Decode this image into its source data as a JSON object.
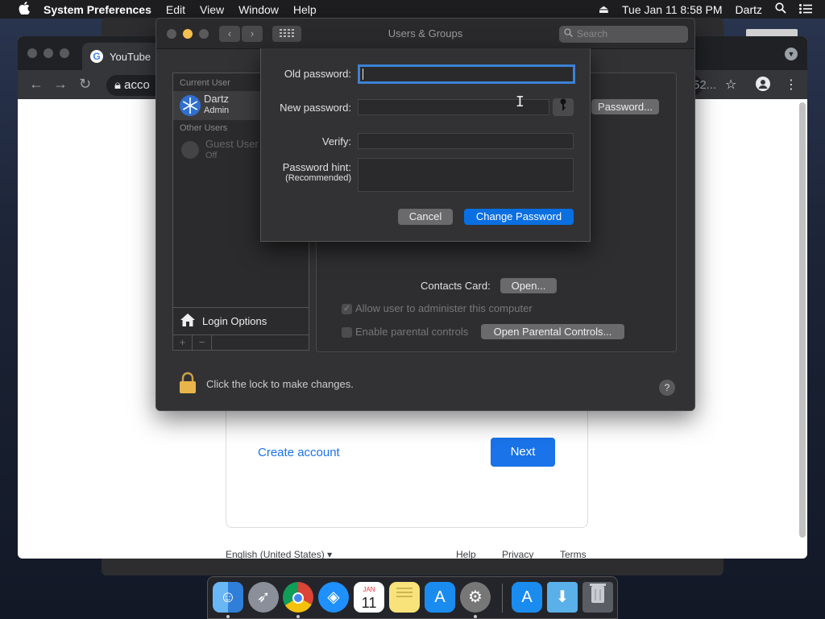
{
  "menubar": {
    "apple": "",
    "app_name": "System Preferences",
    "menus": [
      "Edit",
      "View",
      "Window",
      "Help"
    ],
    "datetime": "Tue Jan 11  8:58 PM",
    "user": "Dartz"
  },
  "chrome": {
    "tab_title": "YouTube",
    "omnibox_text": "acco",
    "omnibox_tail": "52...",
    "create_account": "Create account",
    "next": "Next",
    "language": "English (United States)",
    "footer_help": "Help",
    "footer_privacy": "Privacy",
    "footer_terms": "Terms"
  },
  "sysprefs": {
    "title": "Users & Groups",
    "search_placeholder": "Search",
    "current_user_header": "Current User",
    "current_user_name": "Dartz",
    "current_user_role": "Admin",
    "other_users_header": "Other Users",
    "guest_name": "Guest User",
    "guest_status": "Off",
    "login_options": "Login Options",
    "change_password_btn": "Password...",
    "contacts_card_label": "Contacts Card:",
    "open_btn": "Open...",
    "allow_admin": "Allow user to administer this computer",
    "enable_parental": "Enable parental controls",
    "open_parental_btn": "Open Parental Controls...",
    "lock_text": "Click the lock to make changes.",
    "help": "?"
  },
  "sheet": {
    "old_password_label": "Old password:",
    "new_password_label": "New password:",
    "verify_label": "Verify:",
    "hint_label": "Password hint:",
    "hint_sub": "(Recommended)",
    "old_password_value": "",
    "cancel": "Cancel",
    "change_password": "Change Password"
  },
  "dock": {
    "apps": [
      "Finder",
      "Launchpad",
      "Chrome",
      "Safari",
      "Calendar",
      "Notes",
      "App Store",
      "System Preferences",
      "App Store (downloads)",
      "Downloads",
      "Trash"
    ],
    "calendar_month": "JAN",
    "calendar_day": "11"
  },
  "colors": {
    "accent": "#0a6fe0",
    "google_blue": "#1a73e8",
    "focus_ring": "#3b82d6"
  }
}
